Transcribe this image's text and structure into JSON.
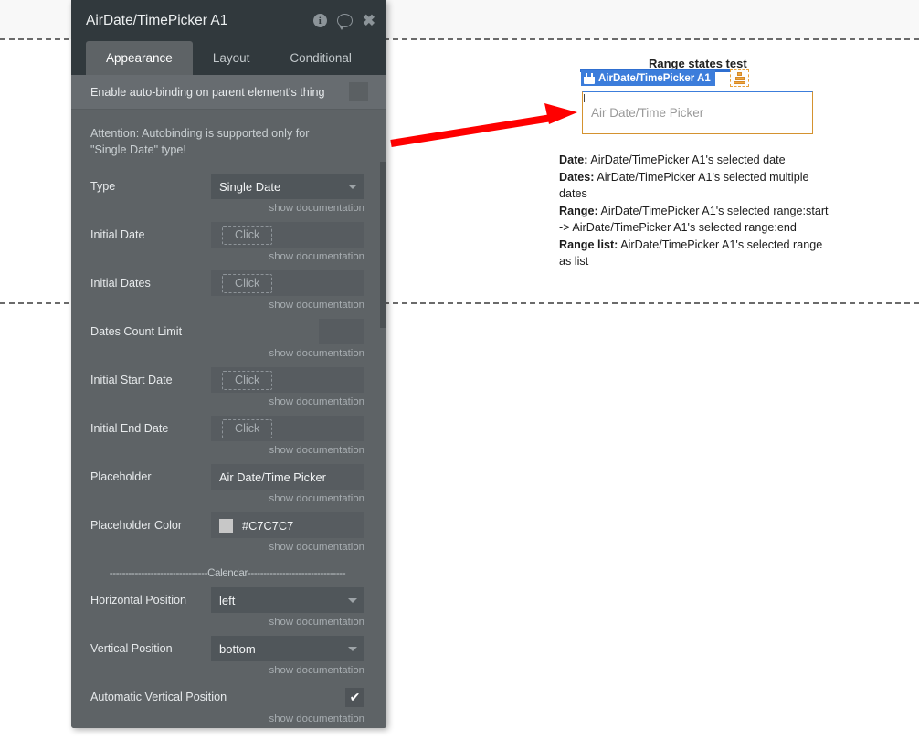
{
  "canvas": {
    "group_title": "Range states test",
    "element_badge": {
      "label": "AirDate/TimePicker A1",
      "calendar_icon": "calendar-icon",
      "stack_icon": "stack-layers-icon"
    },
    "picker": {
      "placeholder": "Air Date/Time Picker"
    },
    "states_text": {
      "line1_label": "Date:",
      "line1_value": "AirDate/TimePicker A1's selected date",
      "line2_label": "Dates:",
      "line2_value": "AirDate/TimePicker A1's selected multiple dates",
      "line3_label": "Range:",
      "line3_value": "AirDate/TimePicker A1's selected range:start -> AirDate/TimePicker A1's selected range:end",
      "line4_label": "Range list:",
      "line4_value": "AirDate/TimePicker A1's selected range as list"
    },
    "annotation": {
      "arrow_color": "#FF0000",
      "arrow_icon": "red-arrow-annotation"
    }
  },
  "panel": {
    "title": "AirDate/TimePicker A1",
    "header_icons": {
      "info": "i",
      "info_name": "info-icon",
      "chat_name": "comment-icon",
      "close": "✖",
      "close_name": "close-icon"
    },
    "tabs": [
      {
        "label": "Appearance",
        "active": true
      },
      {
        "label": "Layout",
        "active": false
      },
      {
        "label": "Conditional",
        "active": false
      }
    ],
    "autobinding": {
      "label": "Enable auto-binding on parent element's thing",
      "checked": false
    },
    "attention": "Attention: Autobinding is supported only for \"Single Date\" type!",
    "doc_link": "show documentation",
    "calendar_divider": "-------------------------------Calendar-------------------------------",
    "properties": [
      {
        "label": "Type",
        "control": "select",
        "value": "Single Date"
      },
      {
        "label": "Initial Date",
        "control": "click",
        "value": "Click"
      },
      {
        "label": "Initial Dates",
        "control": "click",
        "value": "Click"
      },
      {
        "label": "Dates Count Limit",
        "control": "number",
        "value": ""
      },
      {
        "label": "Initial Start Date",
        "control": "click",
        "value": "Click"
      },
      {
        "label": "Initial End Date",
        "control": "click",
        "value": "Click"
      },
      {
        "label": "Placeholder",
        "control": "text",
        "value": "Air Date/Time Picker"
      },
      {
        "label": "Placeholder Color",
        "control": "color",
        "value": "#C7C7C7",
        "swatch": "#C7C7C7"
      }
    ],
    "calendar_properties": [
      {
        "label": "Horizontal Position",
        "control": "select",
        "value": "left"
      },
      {
        "label": "Vertical Position",
        "control": "select",
        "value": "bottom"
      },
      {
        "label": "Automatic Vertical Position",
        "control": "checkbox",
        "value": "✔",
        "checked": true
      }
    ]
  }
}
